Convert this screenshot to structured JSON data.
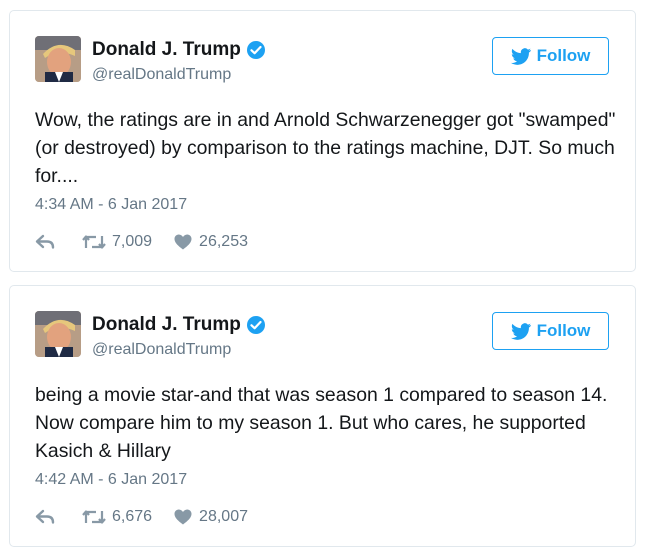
{
  "tweets": [
    {
      "display_name": "Donald J. Trump",
      "handle": "@realDonaldTrump",
      "follow_label": "Follow",
      "text": "Wow, the ratings are in and Arnold Schwarzenegger got \"swamped\" (or destroyed) by comparison to the ratings machine, DJT. So much for....",
      "timestamp": "4:34 AM - 6 Jan 2017",
      "retweets": "7,009",
      "likes": "26,253"
    },
    {
      "display_name": "Donald J. Trump",
      "handle": "@realDonaldTrump",
      "follow_label": "Follow",
      "text": "being a movie star-and that was season 1 compared to season 14. Now compare him to my season 1. But who cares, he supported Kasich & Hillary",
      "timestamp": "4:42 AM - 6 Jan 2017",
      "retweets": "6,676",
      "likes": "28,007"
    }
  ],
  "icons": {
    "verified": "verified-badge-icon",
    "follow": "twitter-bird-icon",
    "reply": "reply-icon",
    "retweet": "retweet-icon",
    "like": "heart-icon"
  },
  "colors": {
    "accent": "#1da1f2",
    "text": "#14171a",
    "muted": "#657786",
    "icon": "#8899a6",
    "border": "#e1e8ed"
  }
}
